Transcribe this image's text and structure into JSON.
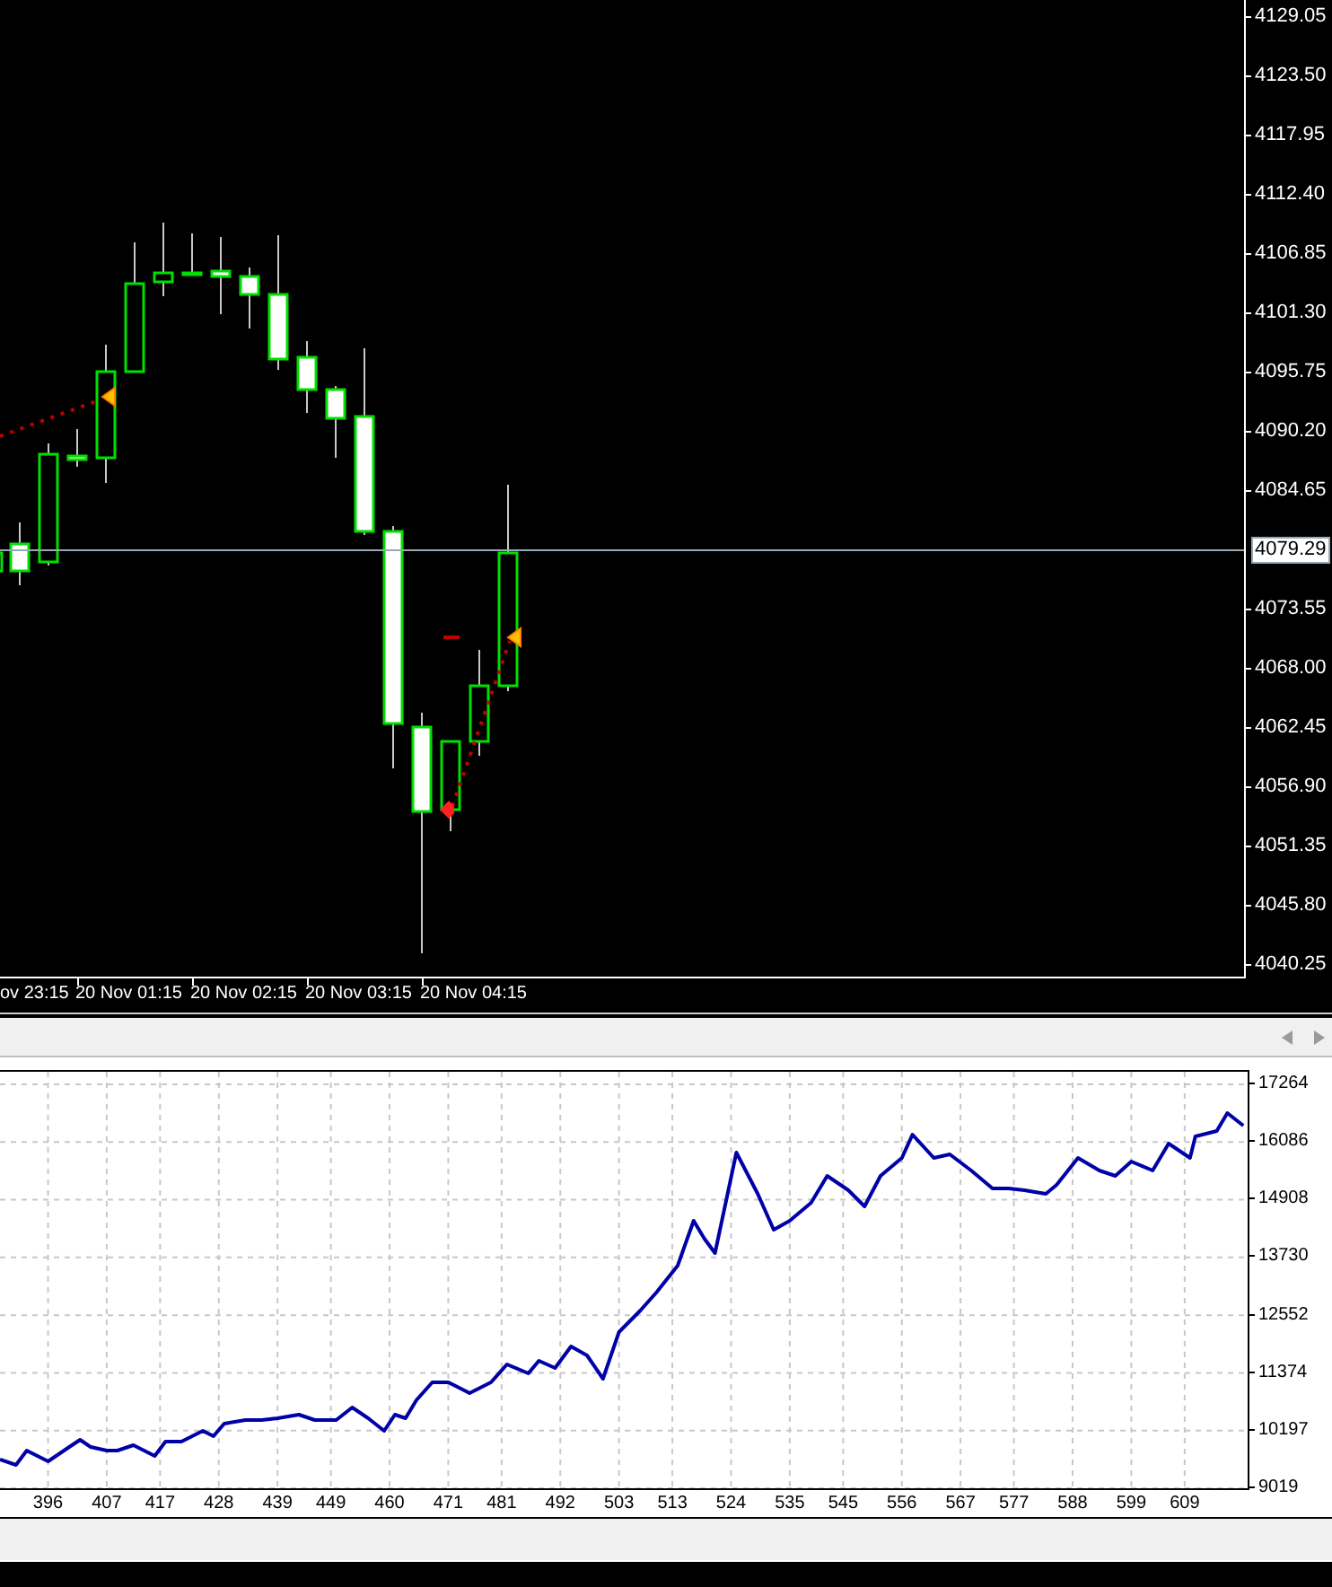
{
  "price_chart": {
    "price_axis": [
      {
        "label": "4129.05",
        "kind": "tick"
      },
      {
        "label": "4123.50",
        "kind": "tick"
      },
      {
        "label": "4117.95",
        "kind": "tick"
      },
      {
        "label": "4112.40",
        "kind": "tick"
      },
      {
        "label": "4106.85",
        "kind": "tick"
      },
      {
        "label": "4101.30",
        "kind": "tick"
      },
      {
        "label": "4095.75",
        "kind": "tick"
      },
      {
        "label": "4090.20",
        "kind": "tick"
      },
      {
        "label": "4084.65",
        "kind": "tick"
      },
      {
        "label": "4079.29",
        "kind": "current"
      },
      {
        "label": "4073.55",
        "kind": "tick"
      },
      {
        "label": "4068.00",
        "kind": "tick"
      },
      {
        "label": "4062.45",
        "kind": "tick"
      },
      {
        "label": "4056.90",
        "kind": "tick"
      },
      {
        "label": "4051.35",
        "kind": "tick"
      },
      {
        "label": "4045.80",
        "kind": "tick"
      },
      {
        "label": "4040.25",
        "kind": "tick"
      }
    ],
    "time_axis": [
      "ov 23:15",
      "20 Nov 01:15",
      "20 Nov 02:15",
      "20 Nov 03:15",
      "20 Nov 04:15"
    ]
  },
  "equity_chart": {
    "chart_data": {
      "type": "line",
      "grid": true,
      "xlim": [
        387,
        620.8
      ],
      "ylim": [
        9019,
        17520
      ],
      "xticks": [
        396,
        407,
        417,
        428,
        439,
        449,
        460,
        471,
        481,
        492,
        503,
        513,
        524,
        535,
        545,
        556,
        567,
        577,
        588,
        599,
        609
      ],
      "yticks": [
        17264,
        16086,
        14908,
        13730,
        12552,
        11374,
        10197,
        9019
      ],
      "x": [
        387,
        390,
        392,
        396,
        400,
        402,
        404,
        407,
        409,
        412,
        416,
        418,
        421,
        425,
        427,
        429,
        433,
        436,
        439,
        443,
        446,
        450,
        453,
        456,
        459,
        461,
        463,
        465,
        468,
        471,
        475,
        479,
        482,
        486,
        488,
        491,
        494,
        497,
        500,
        503,
        507,
        510,
        514,
        517,
        519,
        521,
        525,
        529,
        532,
        535,
        539,
        542,
        546,
        549,
        552,
        556,
        558,
        562,
        565,
        569,
        573,
        576,
        579,
        583,
        585,
        589,
        593,
        596,
        599,
        603,
        606,
        610,
        611,
        615,
        617,
        620
      ],
      "series": [
        {
          "color": "#0000a8",
          "values": [
            9606,
            9496,
            9789,
            9570,
            9863,
            10009,
            9863,
            9789,
            9789,
            9899,
            9680,
            9973,
            9973,
            10192,
            10083,
            10339,
            10412,
            10412,
            10449,
            10522,
            10412,
            10412,
            10669,
            10449,
            10192,
            10522,
            10449,
            10815,
            11182,
            11182,
            10962,
            11182,
            11548,
            11365,
            11621,
            11475,
            11915,
            11731,
            11255,
            12208,
            12647,
            13014,
            13563,
            14479,
            14113,
            13820,
            15872,
            15029,
            14296,
            14479,
            14846,
            15395,
            15102,
            14772,
            15395,
            15762,
            16238,
            15762,
            15835,
            15505,
            15139,
            15139,
            15102,
            15029,
            15212,
            15762,
            15505,
            15395,
            15688,
            15505,
            16055,
            15762,
            16201,
            16311,
            16678,
            16421
          ]
        }
      ]
    }
  }
}
